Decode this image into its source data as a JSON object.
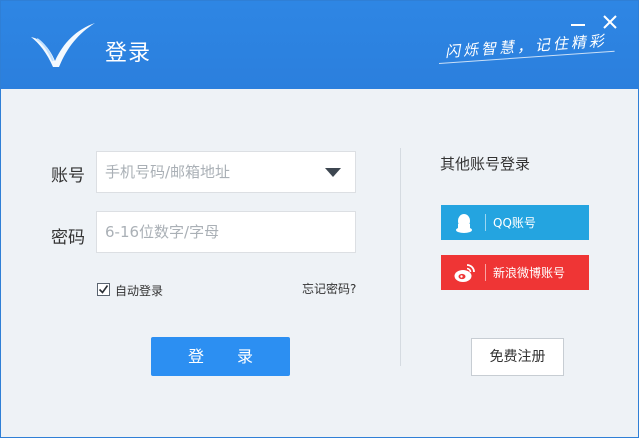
{
  "window": {
    "title": "登录",
    "slogan": "闪烁智慧，记住精彩",
    "accent_color": "#2b80de",
    "minimize_icon": "minimize-icon",
    "close_icon": "close-icon"
  },
  "form": {
    "account_label": "账号",
    "account_placeholder": "手机号码/邮箱地址",
    "password_label": "密码",
    "password_placeholder": "6-16位数字/字母",
    "auto_login_label": "自动登录",
    "auto_login_checked": true,
    "forgot_label": "忘记密码?",
    "login_button": "登 录"
  },
  "social": {
    "title": "其他账号登录",
    "qq_label": "QQ账号",
    "qq_color": "#24a4e0",
    "weibo_label": "新浪微博账号",
    "weibo_color": "#ef3535",
    "register_button": "免费注册"
  }
}
